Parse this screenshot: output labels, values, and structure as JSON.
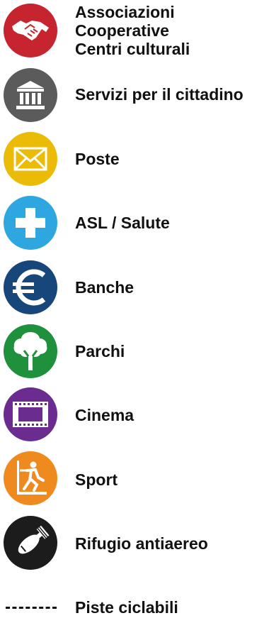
{
  "legend": {
    "items": [
      {
        "id": "associazioni",
        "lines": [
          "Associazioni",
          "Cooperative",
          "Centri culturali"
        ],
        "icon": "handshake-icon",
        "color": "#c6252f"
      },
      {
        "id": "servizi",
        "label": "Servizi per il cittadino",
        "icon": "government-building-icon",
        "color": "#5b5b5b"
      },
      {
        "id": "poste",
        "label": "Poste",
        "icon": "envelope-icon",
        "color": "#eabb07"
      },
      {
        "id": "asl",
        "label": "ASL / Salute",
        "icon": "cross-icon",
        "color": "#2ea7e0"
      },
      {
        "id": "banche",
        "label": "Banche",
        "icon": "euro-icon",
        "color": "#17467b"
      },
      {
        "id": "parchi",
        "label": "Parchi",
        "icon": "tree-icon",
        "color": "#1f913d"
      },
      {
        "id": "cinema",
        "label": "Cinema",
        "icon": "film-icon",
        "color": "#6a2d8f"
      },
      {
        "id": "sport",
        "label": "Sport",
        "icon": "treadmill-icon",
        "color": "#ef8a1e"
      },
      {
        "id": "rifugio",
        "label": "Rifugio antiaereo",
        "icon": "bomb-icon",
        "color": "#1c1c1c"
      },
      {
        "id": "piste",
        "label": "Piste ciclabili",
        "icon": "dashed-line"
      }
    ]
  }
}
